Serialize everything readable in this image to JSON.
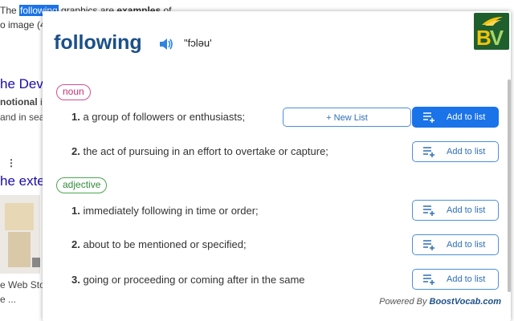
{
  "background": {
    "line1_pre": "The ",
    "line1_highlight": "following",
    "line1_mid": " graphics are ",
    "line1_bold": "examples",
    "line1_post": " of",
    "line2": "o image (4",
    "heading1": "he Dev",
    "text1_bold": "notional",
    "text1_post": " in",
    "text2": "and in sea",
    "menu_dots": "⋮",
    "heading2": "he exte",
    "text3": "e Web Sto",
    "text4": "e ..."
  },
  "popup": {
    "word": "following",
    "phonetic": "\"fɔləu'",
    "logo_letters": {
      "b": "B",
      "v": "V"
    },
    "senses": [
      {
        "pos": "noun",
        "definitions": [
          {
            "num": "1.",
            "text": "a group of followers or enthusiasts;",
            "button": "Add to list",
            "active": true,
            "new_list": "+ New List"
          },
          {
            "num": "2.",
            "text": "the act of pursuing in an effort to overtake or capture;",
            "button": "Add to list"
          }
        ]
      },
      {
        "pos": "adjective",
        "definitions": [
          {
            "num": "1.",
            "text": "immediately following in time or order;",
            "button": "Add to list"
          },
          {
            "num": "2.",
            "text": "about to be mentioned or specified;",
            "button": "Add to list"
          },
          {
            "num": "3.",
            "text": "going or proceeding or coming after in the same",
            "button": "Add to list"
          }
        ]
      }
    ],
    "powered_prefix": "Powered By ",
    "powered_brand": "BoostVocab.com"
  },
  "colors": {
    "word": "#1b4f8a",
    "noun": "#c7307a",
    "adjective": "#2e8b3a",
    "accent": "#1a73e8"
  }
}
